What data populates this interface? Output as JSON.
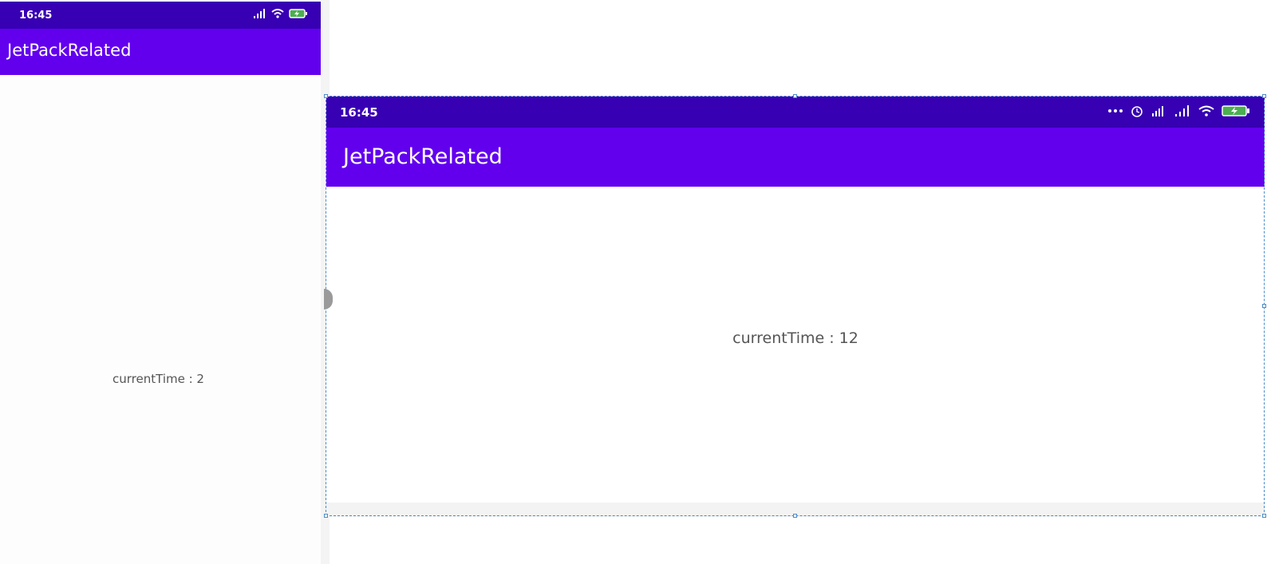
{
  "left_phone": {
    "status_time": "16:45",
    "app_title": "JetPackRelated",
    "current_time_label": "currentTime : 2"
  },
  "right_phone": {
    "status_time": "16:45",
    "app_title": "JetPackRelated",
    "current_time_label": "currentTime : 12"
  },
  "colors": {
    "status_bar": "#3700b3",
    "app_bar": "#6200ee",
    "selection_border": "#4a8cc8"
  },
  "icons": [
    "signal-icon",
    "wifi-icon",
    "battery-charging-icon",
    "more-dots-icon",
    "alarm-icon",
    "hd-signal-icon"
  ]
}
